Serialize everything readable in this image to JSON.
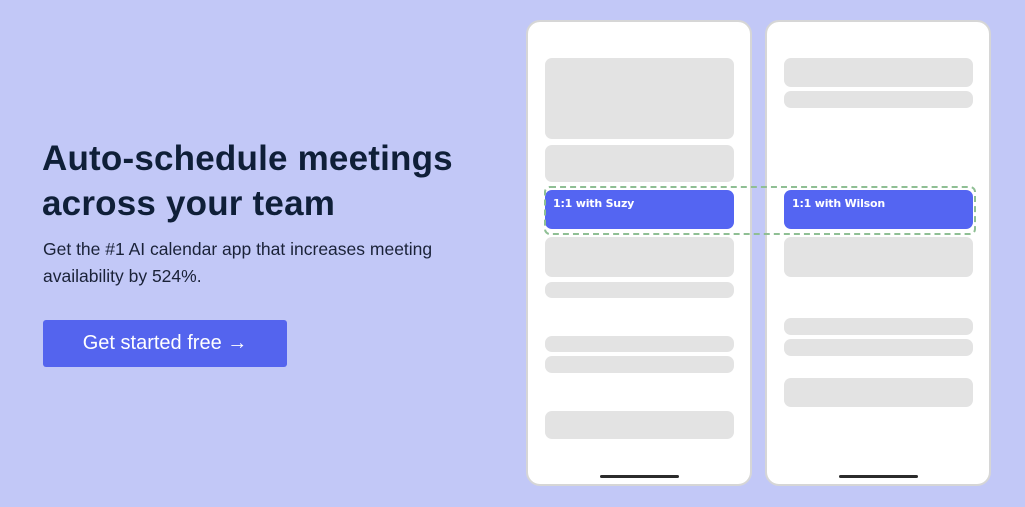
{
  "hero": {
    "headline_line1": "Auto-schedule meetings",
    "headline_line2": "across your team",
    "subtext": "Get the #1 AI calendar app that increases meeting availability by 524%.",
    "cta_label": "Get started free →"
  },
  "illustration": {
    "phones": [
      {
        "event_label": "1:1 with Suzy"
      },
      {
        "event_label": "1:1 with Wilson"
      }
    ],
    "colors": {
      "background": "#c2c8f7",
      "event": "#5465f2",
      "placeholder": "#e3e3e3",
      "match_outline": "#8fbf94",
      "cta": "#5464ee"
    }
  }
}
